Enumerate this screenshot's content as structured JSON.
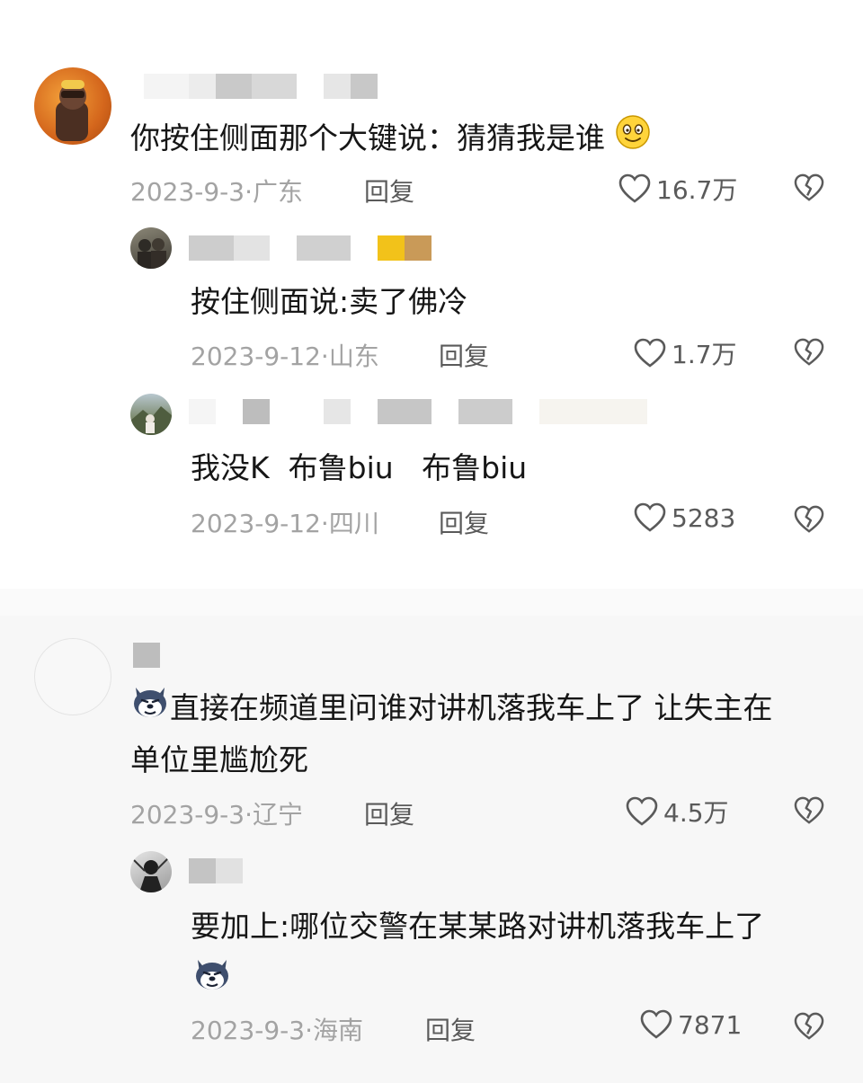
{
  "comments": [
    {
      "text": "你按住侧面那个大键说：猜猜我是谁",
      "date": "2023-9-3",
      "location": "广东",
      "reply_label": "回复",
      "likes": "16.7万",
      "emoji": "smiling-face-icon",
      "replies": [
        {
          "text": "按住侧面说:卖了佛冷",
          "date": "2023-9-12",
          "location": "山东",
          "reply_label": "回复",
          "likes": "1.7万"
        },
        {
          "text": "我没K  布鲁biu   布鲁biu",
          "date": "2023-9-12",
          "location": "四川",
          "reply_label": "回复",
          "likes": "5283"
        }
      ]
    },
    {
      "text_line1": "直接在频道里问谁对讲机落我车上了 让失主在",
      "text_line2": "单位里尴尬死",
      "emoji": "husky-dog-icon",
      "date": "2023-9-3",
      "location": "辽宁",
      "reply_label": "回复",
      "likes": "4.5万",
      "replies": [
        {
          "text": "要加上:哪位交警在某某路对讲机落我车上了",
          "emoji": "husky-dog-icon",
          "date": "2023-9-3",
          "location": "海南",
          "reply_label": "回复",
          "likes": "7871"
        }
      ]
    }
  ],
  "meta_separator": "·",
  "colors": {
    "meta_text": "#a3a3a3",
    "action_text": "#5a5a5a",
    "comment_text": "#161616",
    "section2_background": "#f7f7f7"
  }
}
